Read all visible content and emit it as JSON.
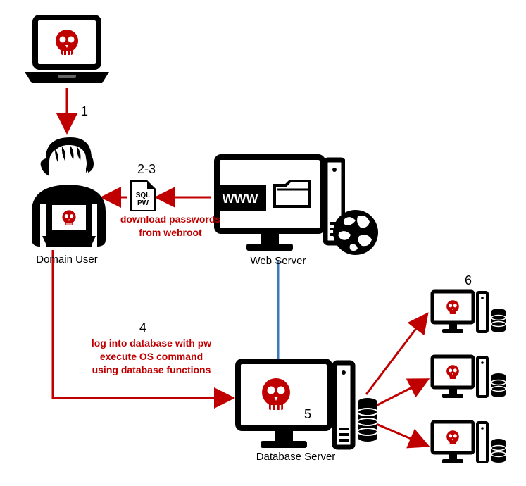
{
  "steps": {
    "s1": "1",
    "s23": "2-3",
    "s4": "4",
    "s5": "5",
    "s6": "6"
  },
  "labels": {
    "domain_user": "Domain User",
    "web_server": "Web Server",
    "database_server": "Database Server",
    "sql": "SQL",
    "pw": "PW",
    "www": "WWW"
  },
  "annotations": {
    "download": "download passwords\nfrom webroot",
    "login": "log into database with pw\nexecute OS command\nusing database functions"
  },
  "colors": {
    "red": "#c00000",
    "blue": "#3a7bbf",
    "black": "#000000"
  }
}
